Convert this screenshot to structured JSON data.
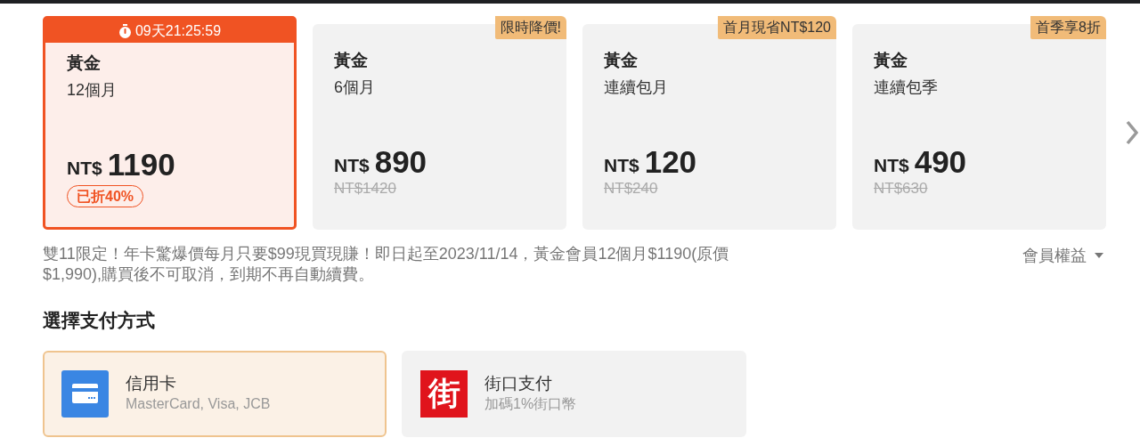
{
  "plans": [
    {
      "tier": "黃金",
      "term": "12個月",
      "currency": "NT$",
      "price": "1190",
      "selected": true,
      "countdown": "09天21:25:59",
      "discount": "已折40%"
    },
    {
      "tier": "黃金",
      "term": "6個月",
      "currency": "NT$",
      "price": "890",
      "selected": false,
      "badge": "限時降價!",
      "original_price": "NT$1420"
    },
    {
      "tier": "黃金",
      "term": "連續包月",
      "currency": "NT$",
      "price": "120",
      "selected": false,
      "badge": "首月現省NT$120",
      "original_price": "NT$240"
    },
    {
      "tier": "黃金",
      "term": "連續包季",
      "currency": "NT$",
      "price": "490",
      "selected": false,
      "badge": "首季享8折",
      "original_price": "NT$630"
    }
  ],
  "promo_text": "雙11限定！年卡驚爆價每月只要$99現買現賺！即日起至2023/11/14，黃金會員12個月$1190(原價\n$1,990),購買後不可取消，到期不再自動續費。",
  "benefits_link": "會員權益",
  "payment_title": "選擇支付方式",
  "payment_methods": [
    {
      "kind": "card",
      "name": "信用卡",
      "detail": "MasterCard, Visa, JCB",
      "selected": true
    },
    {
      "kind": "jkopay",
      "logo_char": "街",
      "name": "街口支付",
      "detail": "加碼1%街口幣",
      "selected": false
    }
  ]
}
